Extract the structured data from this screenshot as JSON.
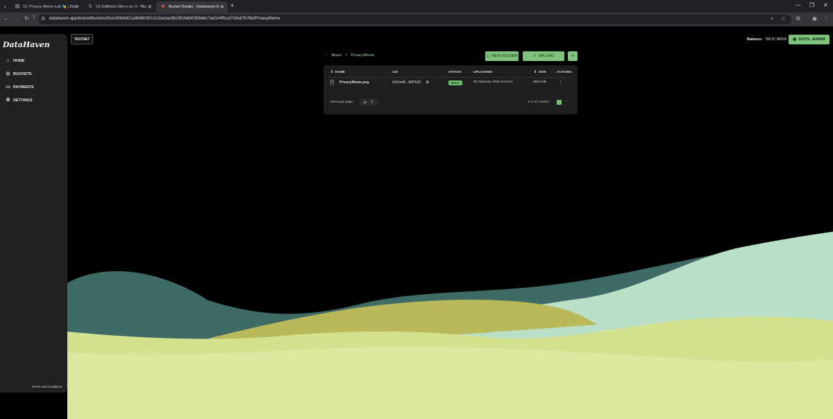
{
  "browser": {
    "tabs": [
      {
        "title": "13. Privacy Meme Lab 🎭 | Dat",
        "icon": "page-icon",
        "active": false
      },
      {
        "title": "(2) Edilberto Marco en X: \"Made",
        "icon": "x-logo-icon",
        "active": false
      },
      {
        "title": "Bucket Details - DataHaven App",
        "icon": "datahaven-icon",
        "active": true
      }
    ],
    "new_tab": "+",
    "url": "datahaven.app/testnet/buckets/0xe180e5d21a9b68c9212c1ba2ac8b18f1fab9035b8ec7ad144ffccd7d3e67b7bb/PrivacyMeme",
    "reload_badge": "7"
  },
  "sidebar": {
    "logo": "DataHaven",
    "items": [
      {
        "label": "HOME",
        "icon": "home-icon"
      },
      {
        "label": "BUCKETS",
        "icon": "buckets-icon"
      },
      {
        "label": "PAYMENTS",
        "icon": "payments-icon"
      },
      {
        "label": "SETTINGS",
        "icon": "settings-icon"
      }
    ],
    "terms": "Terms and Conditions"
  },
  "header": {
    "network_badge": "TESTNET",
    "balance_label": "Balance:",
    "balance_value": "799.97 MOCK",
    "wallet": "0X275...BA6B6"
  },
  "breadcrumb": {
    "root": "Bruce",
    "separator": "/",
    "current": "PrivacyMeme"
  },
  "actions": {
    "new_folder": "NEW FOLDER",
    "upload": "UPLOAD"
  },
  "table": {
    "columns": {
      "name": "NAME",
      "cid": "CID",
      "status": "STATUS",
      "uploaded": "UPLOADED",
      "size": "SIZE",
      "actions": "ACTIONS"
    },
    "rows": [
      {
        "name": "PrivacyMeme.png",
        "cid": "0x51e46...fb87b53",
        "status": "READY",
        "uploaded": "06 February 2026 at 03:51",
        "size": "586.9 kB"
      }
    ],
    "items_per_page_label": "Items per page:",
    "items_per_page": "10",
    "range": "1–1 of 1 items",
    "current_page": "1"
  },
  "colors": {
    "accent": "#7ec27e",
    "panel": "#1e1e1e",
    "sidebar": "#212121"
  }
}
